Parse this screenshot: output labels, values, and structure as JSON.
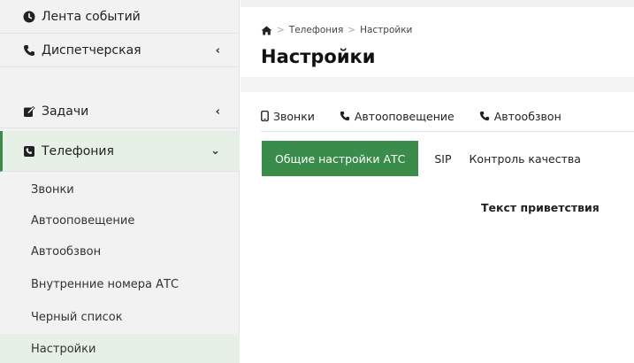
{
  "sidebar": {
    "items": [
      {
        "label": "Лента событий",
        "icon": "clock-icon"
      },
      {
        "label": "Диспетчерская",
        "icon": "phone-icon"
      },
      {
        "label": "Задачи",
        "icon": "edit-icon"
      },
      {
        "label": "Телефония",
        "icon": "phone-square-icon"
      }
    ],
    "sub_items": [
      {
        "label": "Звонки"
      },
      {
        "label": "Автооповещение"
      },
      {
        "label": "Автообзвон"
      },
      {
        "label": "Внутренние номера АТС"
      },
      {
        "label": "Черный список"
      },
      {
        "label": "Настройки"
      }
    ]
  },
  "breadcrumb": {
    "home_icon": "home-icon",
    "items": [
      "Телефония",
      "Настройки"
    ],
    "separator": ">"
  },
  "page_title": "Настройки",
  "tabs": [
    {
      "label": "Звонки",
      "icon": "mobile-icon"
    },
    {
      "label": "Автооповещение",
      "icon": "phone-icon"
    },
    {
      "label": "Автообзвон",
      "icon": "phone-icon"
    }
  ],
  "subtabs": [
    {
      "label": "Общие настройки АТС",
      "active": true
    },
    {
      "label": "SIP"
    },
    {
      "label": "Контроль качества"
    }
  ],
  "content": {
    "greeting_label": "Текст приветствия"
  },
  "colors": {
    "accent": "#3a8c4a",
    "sidebar_bg": "#f2f2f2",
    "active_bg": "#e6f0e6"
  }
}
